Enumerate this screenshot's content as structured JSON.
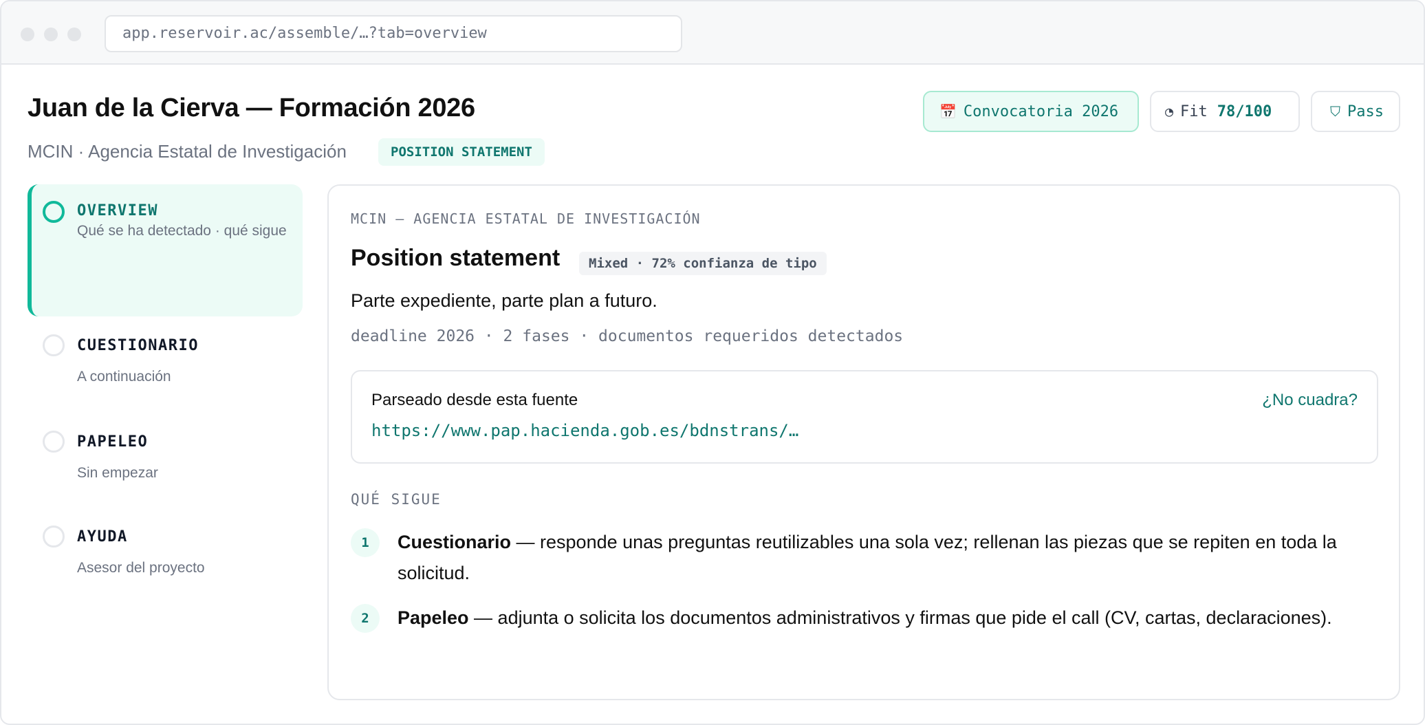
{
  "browser": {
    "url": "app.reservoir.ac/assemble/…?tab=overview"
  },
  "header": {
    "title": "Juan de la Cierva — Formación 2026",
    "subtitle": "MCIN · Agencia Estatal de Investigación",
    "type_badge": "POSITION STATEMENT",
    "convocatoria_icon": "calendar-icon",
    "convocatoria": "Convocatoria 2026",
    "fit_icon": "pie-icon",
    "fit_label": "Fit",
    "fit_value": "78/100",
    "pass_icon": "shield-icon",
    "pass_label": "Pass"
  },
  "steps": [
    {
      "label": "OVERVIEW",
      "desc": "Qué se ha detectado · qué sigue",
      "active": true
    },
    {
      "label": "CUESTIONARIO",
      "desc": "A continuación",
      "active": false
    },
    {
      "label": "PAPELEO",
      "desc": "Sin empezar",
      "active": false
    },
    {
      "label": "AYUDA",
      "desc": "Asesor del proyecto",
      "active": false
    }
  ],
  "panel": {
    "agency": "MCIN — AGENCIA ESTATAL DE INVESTIGACIÓN",
    "title": "Position statement",
    "confidence": "Mixed · 72% confianza de tipo",
    "lead": "Parte expediente, parte plan a futuro.",
    "meta": "deadline 2026 · 2 fases · documentos requeridos detectados",
    "source": {
      "label": "Parseado desde esta fuente",
      "link": "https://www.pap.hacienda.gob.es/bdnstrans/…",
      "no_match": "¿No cuadra?"
    },
    "next_heading": "QUÉ SIGUE",
    "next_items": [
      {
        "num": "1",
        "title": "Cuestionario",
        "text": " — responde unas preguntas reutilizables una sola vez; rellenan las piezas que se repiten en toda la solicitud."
      },
      {
        "num": "2",
        "title": "Papeleo",
        "text": " — adjunta o solicita los documentos administrativos y firmas que pide el call (CV, cartas, declaraciones)."
      }
    ]
  },
  "colors": {
    "accent": "#10b99a",
    "accent_text": "#0f766e",
    "accent_bg": "#ecfbf6",
    "border": "#e5e7eb",
    "muted": "#6b7280"
  }
}
